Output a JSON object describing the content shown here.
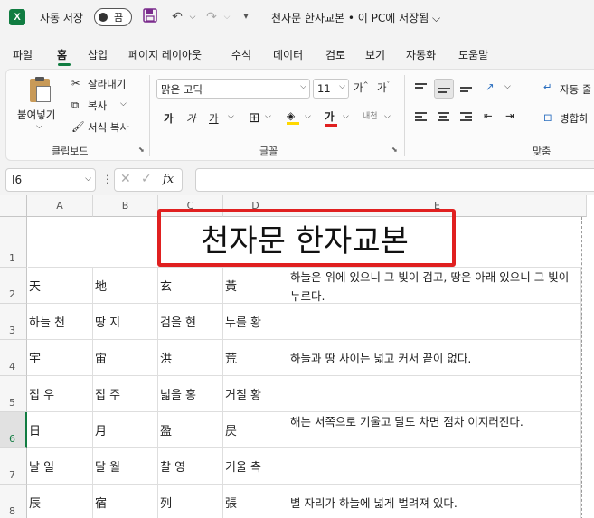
{
  "app": {
    "logo": "X",
    "autosave_label": "자동 저장",
    "autosave_state": "끔",
    "doc_title": "천자문 한자교본 • 이 PC에 저장됨 ⌵"
  },
  "tabs": [
    "파일",
    "홈",
    "삽입",
    "페이지 레이아웃",
    "수식",
    "데이터",
    "검토",
    "보기",
    "자동화",
    "도움말"
  ],
  "ribbon": {
    "clipboard": {
      "paste": "붙여넣기",
      "cut": "잘라내기",
      "copy": "복사",
      "format_painter": "서식 복사",
      "label": "클립보드"
    },
    "font": {
      "font_name": "맑은 고딕",
      "font_size": "11",
      "bold": "가",
      "italic": "가",
      "underline": "가",
      "font_color_glyph": "가",
      "phonetic": "내천",
      "label": "글꼴"
    },
    "alignment": {
      "wrap_text": "자동 줄",
      "merge": "병합하",
      "label": "맞춤"
    }
  },
  "formula_bar": {
    "name_box": "I6",
    "fx": "fx"
  },
  "columns": [
    "A",
    "B",
    "C",
    "D",
    "E"
  ],
  "title": "천자문 한자교본",
  "rows": [
    {
      "num": "1"
    },
    {
      "num": "2",
      "cells": [
        "天",
        "地",
        "玄",
        "黃",
        "하늘은 위에 있으니 그 빛이 검고, 땅은 아래 있으니 그 빛이 누르다."
      ]
    },
    {
      "num": "3",
      "cells": [
        "하늘 천",
        "땅 지",
        "검을 현",
        "누를 황",
        ""
      ]
    },
    {
      "num": "4",
      "cells": [
        "宇",
        "宙",
        "洪",
        "荒",
        "하늘과 땅 사이는 넓고 커서 끝이 없다."
      ]
    },
    {
      "num": "5",
      "cells": [
        "집 우",
        "집 주",
        "넓을 홍",
        "거칠 황",
        ""
      ]
    },
    {
      "num": "6",
      "cells": [
        "日",
        "月",
        "盈",
        "昃",
        "해는 서쪽으로 기울고 달도 차면 점차 이지러진다."
      ]
    },
    {
      "num": "7",
      "cells": [
        "날 일",
        "달 월",
        "찰 영",
        "기울 측",
        ""
      ]
    },
    {
      "num": "8",
      "cells": [
        "辰",
        "宿",
        "列",
        "張",
        "별 자리가 하늘에 넓게 벌려져 있다."
      ]
    }
  ],
  "selected_row": "6",
  "colors": {
    "brand": "#107c41",
    "highlight": "#e02020"
  }
}
